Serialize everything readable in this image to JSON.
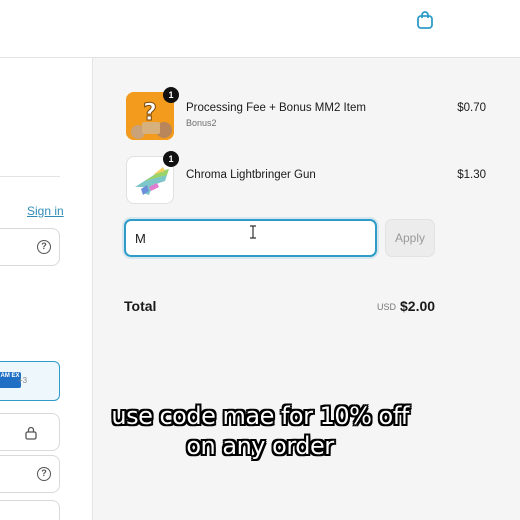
{
  "cart": {
    "items": [
      {
        "name": "Processing Fee + Bonus MM2 Item",
        "subtitle": "Bonus2",
        "price": "$0.70",
        "quantity": "1",
        "thumbnail_icon": "mystery-box-icon"
      },
      {
        "name": "Chroma Lightbringer Gun",
        "subtitle": "",
        "price": "$1.30",
        "quantity": "1",
        "thumbnail_icon": "chroma-gun-icon"
      }
    ]
  },
  "discount": {
    "value": "M",
    "apply_label": "Apply"
  },
  "total": {
    "label": "Total",
    "currency": "USD",
    "amount": "$2.00"
  },
  "account": {
    "signin_label": "Sign in"
  },
  "payment": {
    "extra_cards": "+3",
    "amex_text": "AM EX"
  },
  "caption": {
    "line1": "use code mae for 10% off",
    "line2": "on any order"
  },
  "colors": {
    "accent": "#2f9bc8",
    "link": "#2f8bb5",
    "summary_bg": "#f5f5f5"
  }
}
